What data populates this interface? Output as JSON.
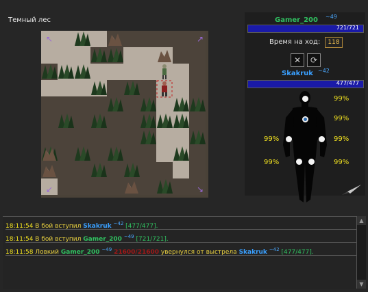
{
  "location": {
    "title": "Темный лес"
  },
  "player": {
    "name": "Gamer_200",
    "level": "~49",
    "hp": "721/721"
  },
  "turn": {
    "label": "Время на ход:",
    "seconds": "118"
  },
  "actions": [
    {
      "icon": "cross-swords-icon",
      "glyph": "✕"
    },
    {
      "icon": "refresh-icon",
      "glyph": "⟳"
    }
  ],
  "opponent": {
    "name": "Skakruk",
    "level": "~42",
    "hp": "477/477"
  },
  "armor": {
    "head": "99%",
    "chest": "99%",
    "left_hand": "99%",
    "right_hand": "99%",
    "left_leg": "99%",
    "right_leg": "99%"
  },
  "colors": {
    "hp_bar": "#1a1aa8",
    "player_name": "#30c060",
    "opponent_name": "#3aa0ff",
    "timestamp": "#f0e020",
    "damage": "#a01818"
  },
  "log": [
    {
      "time": "18:11:54",
      "prefix": "В бой вступил",
      "name": "Skakruk",
      "name_class": "blue",
      "lvl": "~42",
      "hp": "[477/477]."
    },
    {
      "time": "18:11:54",
      "prefix": "В бой вступил",
      "name": "Gamer_200",
      "name_class": "green",
      "lvl": "~49",
      "hp": "[721/721]."
    },
    {
      "time": "18:11:58",
      "prefix": "Ловкий",
      "name": "Gamer_200",
      "name_class": "green",
      "lvl": "~49",
      "damage": "21600/21600",
      "middle": "увернулся от выстрела",
      "name2": "Skakruk",
      "lvl2": "~42",
      "hp": "[477/477]."
    }
  ]
}
